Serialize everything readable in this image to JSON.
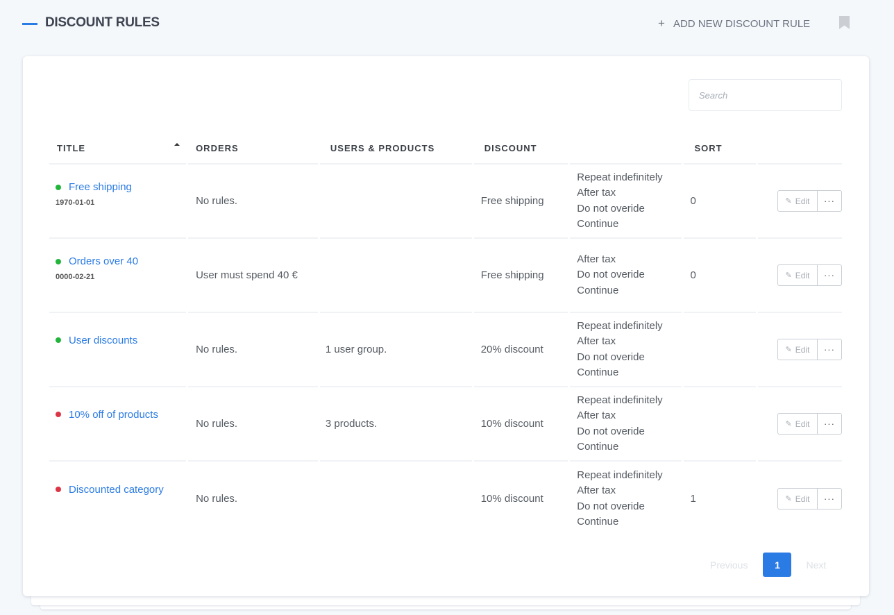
{
  "header": {
    "title": "DISCOUNT RULES",
    "add_button_icon": "+",
    "add_button_label": "ADD NEW DISCOUNT RULE",
    "bookmark_icon": "bookmark-icon"
  },
  "search": {
    "placeholder": "Search",
    "value": ""
  },
  "table": {
    "columns": [
      "TITLE",
      "ORDERS",
      "USERS & PRODUCTS",
      "DISCOUNT",
      "",
      "SORT",
      ""
    ],
    "sorted_column": "TITLE",
    "sort_direction": "ascending",
    "rows": [
      {
        "title": "Free shipping",
        "status": "active",
        "status_color": "#22b53c",
        "date": "1970-01-01",
        "orders": "No rules.",
        "users_products": "",
        "discount": "Free shipping",
        "options": [
          "Repeat indefinitely",
          "After tax",
          "Do not overide",
          "Continue"
        ],
        "sort": "0",
        "edit_label": "Edit",
        "more_label": "···"
      },
      {
        "title": "Orders over 40",
        "status": "active",
        "status_color": "#22b53c",
        "date": "0000-02-21",
        "orders": "User must spend 40 €",
        "users_products": "",
        "discount": "Free shipping",
        "options": [
          "After tax",
          "Do not overide",
          "Continue"
        ],
        "sort": "0",
        "edit_label": "Edit",
        "more_label": "···"
      },
      {
        "title": "User discounts",
        "status": "active",
        "status_color": "#22b53c",
        "date": "",
        "orders": "No rules.",
        "users_products": "1 user group.",
        "discount": "20% discount",
        "options": [
          "Repeat indefinitely",
          "After tax",
          "Do not overide",
          "Continue"
        ],
        "sort": "",
        "edit_label": "Edit",
        "more_label": "···"
      },
      {
        "title": "10% off of products",
        "status": "inactive",
        "status_color": "#dc3545",
        "date": "",
        "orders": "No rules.",
        "users_products": "3 products.",
        "discount": "10% discount",
        "options": [
          "Repeat indefinitely",
          "After tax",
          "Do not overide",
          "Continue"
        ],
        "sort": "",
        "edit_label": "Edit",
        "more_label": "···"
      },
      {
        "title": "Discounted category",
        "status": "inactive",
        "status_color": "#dc3545",
        "date": "",
        "orders": "No rules.",
        "users_products": "",
        "discount": "10% discount",
        "options": [
          "Repeat indefinitely",
          "After tax",
          "Do not overide",
          "Continue"
        ],
        "sort": "1",
        "edit_label": "Edit",
        "more_label": "···"
      }
    ]
  },
  "pagination": {
    "previous_label": "Previous",
    "current_page": "1",
    "next_label": "Next"
  },
  "colors": {
    "accent": "#2b7be5",
    "active": "#22b53c",
    "inactive": "#dc3545"
  }
}
